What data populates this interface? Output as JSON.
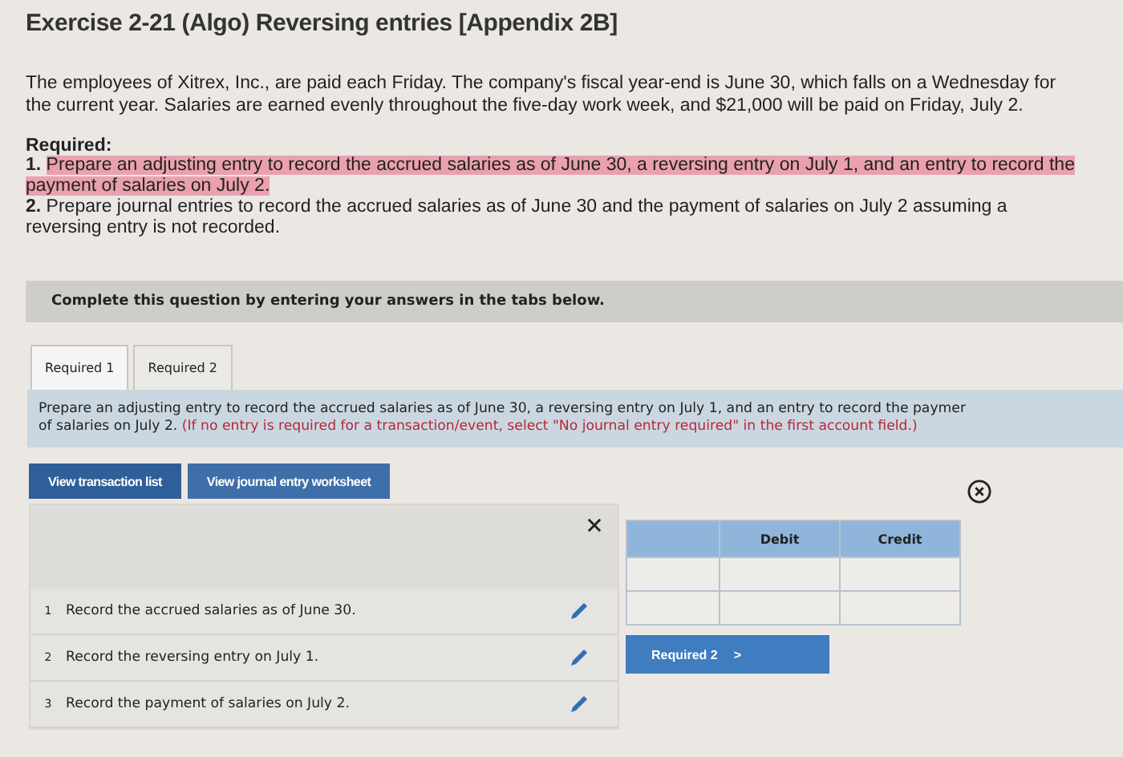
{
  "title": "Exercise 2-21 (Algo) Reversing entries [Appendix 2B]",
  "intro": "The employees of Xitrex, Inc., are paid each Friday. The company's fiscal year-end is June 30, which falls on a Wednesday for the current year. Salaries are earned evenly throughout the five-day work week, and $21,000 will be paid on Friday, July 2.",
  "required_heading": "Required:",
  "required_items": [
    {
      "number": "1.",
      "text": "Prepare an adjusting entry to record the accrued salaries as of June 30, a reversing entry on July 1, and an entry to record the payment of salaries on July 2.",
      "highlighted": true
    },
    {
      "number": "2.",
      "text": "Prepare journal entries to record the accrued salaries as of June 30 and the payment of salaries on July 2 assuming a reversing entry is not recorded.",
      "highlighted": false
    }
  ],
  "banner": "Complete this question by entering your answers in the tabs below.",
  "tabs": [
    {
      "label": "Required 1",
      "selected": true
    },
    {
      "label": "Required 2",
      "selected": false
    }
  ],
  "instruction": {
    "line_1": "Prepare an adjusting entry to record the accrued salaries as of June 30, a reversing entry on July 1, and an entry to record the paymer",
    "line_2": "of salaries on July 2.",
    "note": "(If no entry is required for a transaction/event, select \"No journal entry required\" in the first account field.)"
  },
  "view_buttons": [
    {
      "label": "View transaction list",
      "selected": true
    },
    {
      "label": "View journal entry worksheet",
      "selected": false
    }
  ],
  "transactions": [
    {
      "number": "1",
      "text": "Record the accrued salaries as of June 30."
    },
    {
      "number": "2",
      "text": "Record the reversing entry on July 1."
    },
    {
      "number": "3",
      "text": "Record the payment of salaries on July 2."
    }
  ],
  "table": {
    "columns": [
      "Debit",
      "Credit"
    ]
  },
  "next_button": {
    "label": "Required 2",
    "arrow": ">"
  }
}
